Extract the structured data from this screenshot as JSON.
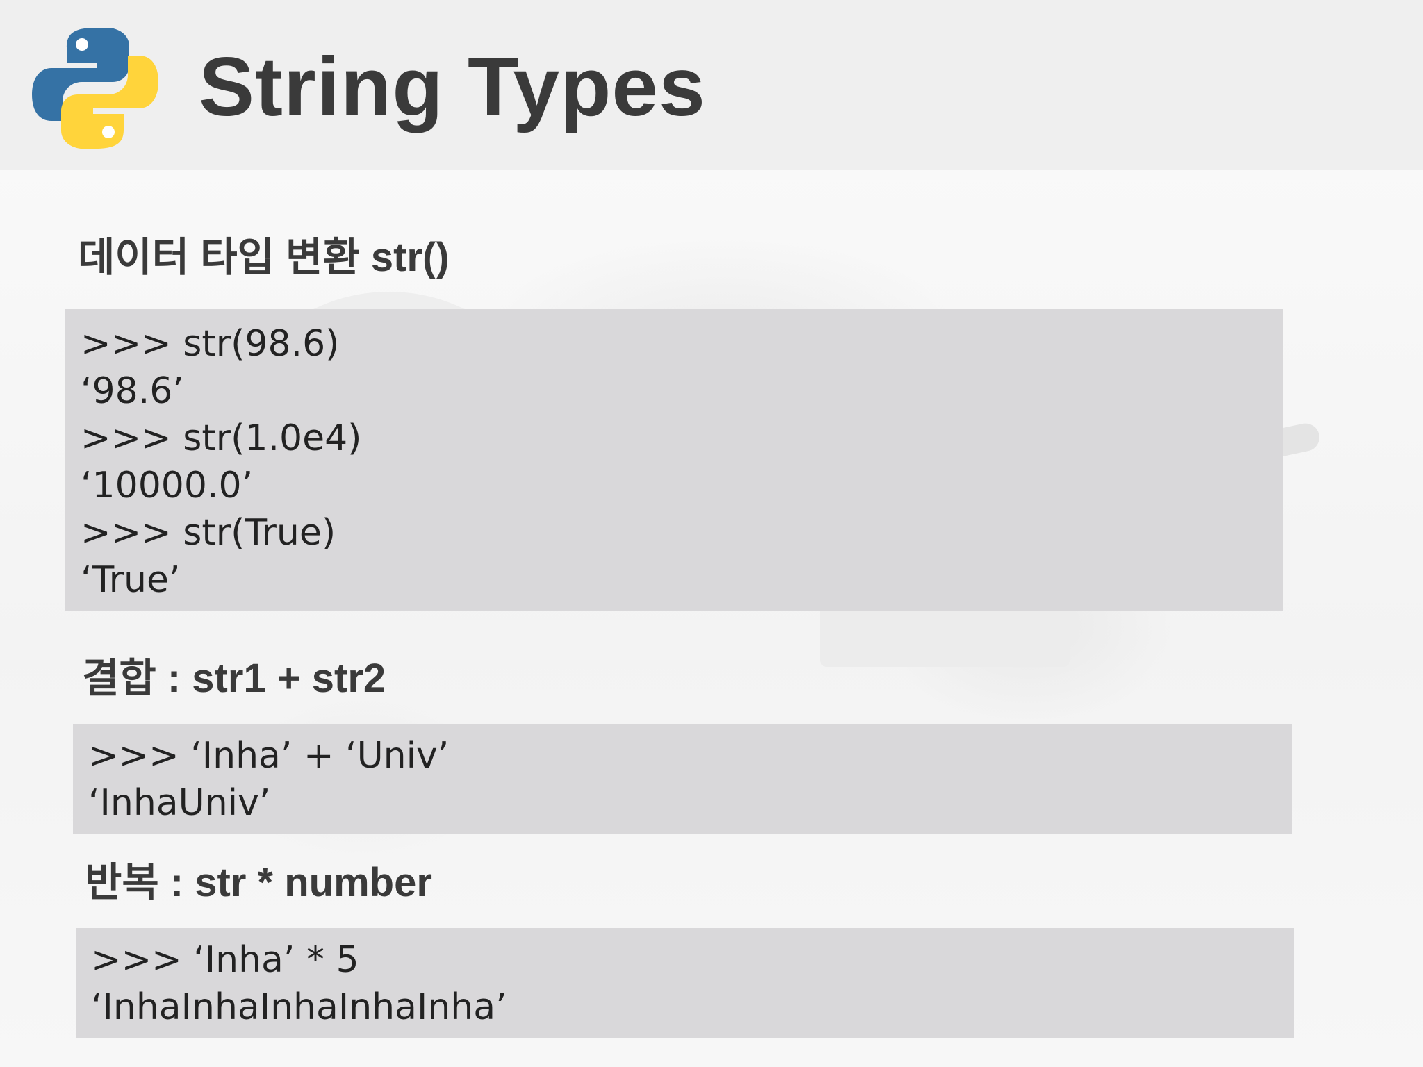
{
  "slide": {
    "title": "String Types",
    "logo_icon": "python-logo-icon"
  },
  "sections": [
    {
      "heading": "데이터 타입 변환 str()",
      "code_lines": [
        ">>> str(98.6)",
        "‘98.6’",
        ">>> str(1.0e4)",
        "‘10000.0’",
        ">>> str(True)",
        "‘True’"
      ]
    },
    {
      "heading": "결합 : str1 + str2",
      "code_lines": [
        ">>> ‘Inha’ + ‘Univ’",
        "‘InhaUniv’"
      ]
    },
    {
      "heading": "반복 : str * number",
      "code_lines": [
        ">>> ‘Inha’ * 5",
        "‘InhaInhaInhaInhaInha’"
      ]
    }
  ],
  "colors": {
    "header_bg": "#efefef",
    "code_bg": "#d9d8da",
    "text": "#3a3a3a",
    "python_blue": "#3572a5",
    "python_yellow": "#ffd43b"
  }
}
